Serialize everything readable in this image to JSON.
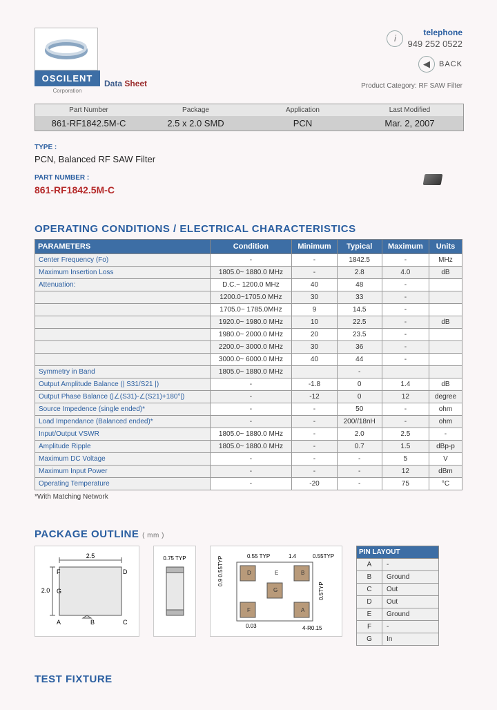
{
  "header": {
    "logo_text": "OSCILENT",
    "logo_sub": "Corporation",
    "data_label": "Data",
    "sheet_label": "Sheet",
    "tel_label": "telephone",
    "tel_number": "949 252 0522",
    "back_label": "BACK",
    "product_category": "Product Category: RF SAW Filter"
  },
  "info_bar": {
    "headers": [
      "Part Number",
      "Package",
      "Application",
      "Last Modified"
    ],
    "values": [
      "861-RF1842.5M-C",
      "2.5 x 2.0 SMD",
      "PCN",
      "Mar. 2, 2007"
    ]
  },
  "type": {
    "label": "TYPE :",
    "value": "PCN, Balanced RF SAW Filter"
  },
  "part_number": {
    "label": "PART NUMBER :",
    "value": "861-RF1842.5M-C"
  },
  "sections": {
    "operating": "OPERATING CONDITIONS / ELECTRICAL CHARACTERISTICS",
    "package": "PACKAGE OUTLINE",
    "package_unit": "( mm )",
    "test_fixture": "TEST FIXTURE"
  },
  "char_table": {
    "headers": [
      "PARAMETERS",
      "Condition",
      "Minimum",
      "Typical",
      "Maximum",
      "Units"
    ],
    "rows": [
      {
        "p": "Center Frequency (Fo)",
        "c": "-",
        "min": "-",
        "typ": "1842.5",
        "max": "-",
        "u": "MHz"
      },
      {
        "p": "Maximum Insertion Loss",
        "c": "1805.0~ 1880.0 MHz",
        "min": "-",
        "typ": "2.8",
        "max": "4.0",
        "u": "dB"
      },
      {
        "p": "Attenuation:",
        "c": "D.C.~ 1200.0 MHz",
        "min": "40",
        "typ": "48",
        "max": "-",
        "u": ""
      },
      {
        "p": "",
        "c": "1200.0~1705.0 MHz",
        "min": "30",
        "typ": "33",
        "max": "-",
        "u": ""
      },
      {
        "p": "",
        "c": "1705.0~ 1785.0MHz",
        "min": "9",
        "typ": "14.5",
        "max": "-",
        "u": ""
      },
      {
        "p": "",
        "c": "1920.0~ 1980.0 MHz",
        "min": "10",
        "typ": "22.5",
        "max": "-",
        "u": "dB"
      },
      {
        "p": "",
        "c": "1980.0~ 2000.0 MHz",
        "min": "20",
        "typ": "23.5",
        "max": "-",
        "u": ""
      },
      {
        "p": "",
        "c": "2200.0~ 3000.0 MHz",
        "min": "30",
        "typ": "36",
        "max": "-",
        "u": ""
      },
      {
        "p": "",
        "c": "3000.0~ 6000.0 MHz",
        "min": "40",
        "typ": "44",
        "max": "-",
        "u": ""
      },
      {
        "p": "Symmetry in Band",
        "c": "1805.0~ 1880.0 MHz",
        "min": "",
        "typ": "-",
        "max": "",
        "u": ""
      },
      {
        "p": "Output Amplitude Balance (| S31/S21 |)",
        "c": "-",
        "min": "-1.8",
        "typ": "0",
        "max": "1.4",
        "u": "dB"
      },
      {
        "p": "Output Phase Balance (|∠(S31)-∠(S21)+180°|)",
        "c": "-",
        "min": "-12",
        "typ": "0",
        "max": "12",
        "u": "degree"
      },
      {
        "p": "Source Impedence (single ended)*",
        "c": "-",
        "min": "-",
        "typ": "50",
        "max": "-",
        "u": "ohm"
      },
      {
        "p": "Load Impendance (Balanced ended)*",
        "c": "-",
        "min": "-",
        "typ": "200//18nH",
        "max": "-",
        "u": "ohm"
      },
      {
        "p": "Input/Output VSWR",
        "c": "1805.0~ 1880.0 MHz",
        "min": "-",
        "typ": "2.0",
        "max": "2.5",
        "u": "-"
      },
      {
        "p": "Amplitude Ripple",
        "c": "1805.0~ 1880.0 MHz",
        "min": "-",
        "typ": "0.7",
        "max": "1.5",
        "u": "dBp-p"
      },
      {
        "p": "Maximum DC Voltage",
        "c": "-",
        "min": "-",
        "typ": "-",
        "max": "5",
        "u": "V"
      },
      {
        "p": "Maximum Input Power",
        "c": "-",
        "min": "-",
        "typ": "-",
        "max": "12",
        "u": "dBm"
      },
      {
        "p": "Operating Temperature",
        "c": "-",
        "min": "-20",
        "typ": "-",
        "max": "75",
        "u": "°C"
      }
    ],
    "footnote": "*With Matching Network"
  },
  "package_dims": {
    "width": "2.5",
    "height": "2.0",
    "pins_left": [
      "F",
      "G",
      "A"
    ],
    "pins_right": [
      "D",
      "B",
      "C"
    ],
    "typ1": "0.75 TYP",
    "typ2": "0.55 TYP",
    "val_14": "1.4",
    "val_055typ": "0.55TYP",
    "val_09": "0.9",
    "val_05typ": "0.5TYP",
    "val_003": "0.03",
    "corner": "4-R0.15"
  },
  "pin_layout": {
    "title": "PIN LAYOUT",
    "rows": [
      [
        "A",
        "-"
      ],
      [
        "B",
        "Ground"
      ],
      [
        "C",
        "Out"
      ],
      [
        "D",
        "Out"
      ],
      [
        "E",
        "Ground"
      ],
      [
        "F",
        "-"
      ],
      [
        "G",
        "In"
      ]
    ]
  }
}
